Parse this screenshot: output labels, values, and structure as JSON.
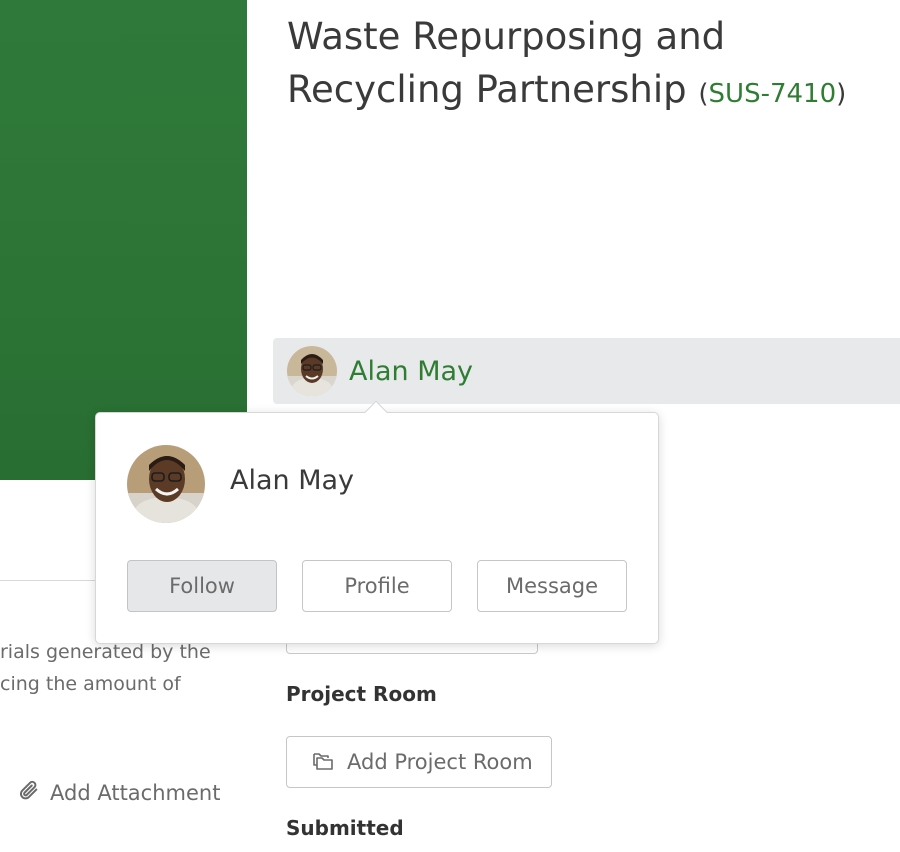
{
  "project": {
    "title": "Waste Repurposing and Recycling Partnership",
    "code_open": "(",
    "code": "SUS-7410",
    "code_close": ")"
  },
  "owner": {
    "name": "Alan May"
  },
  "popover": {
    "name": "Alan May",
    "follow_label": "Follow",
    "profile_label": "Profile",
    "message_label": "Message"
  },
  "description": {
    "line1": "rials generated by the",
    "line2": "cing the amount of"
  },
  "attachment": {
    "label": "Add Attachment",
    "icon": "paperclip-icon"
  },
  "project_room": {
    "heading": "Project Room",
    "button_label": "Add Project Room",
    "icon": "folders-icon"
  },
  "submitted": {
    "heading": "Submitted"
  },
  "colors": {
    "brand_green": "#2e7d32",
    "banner_green": "#2c7436",
    "owner_bar_bg": "#e8e9eb"
  }
}
